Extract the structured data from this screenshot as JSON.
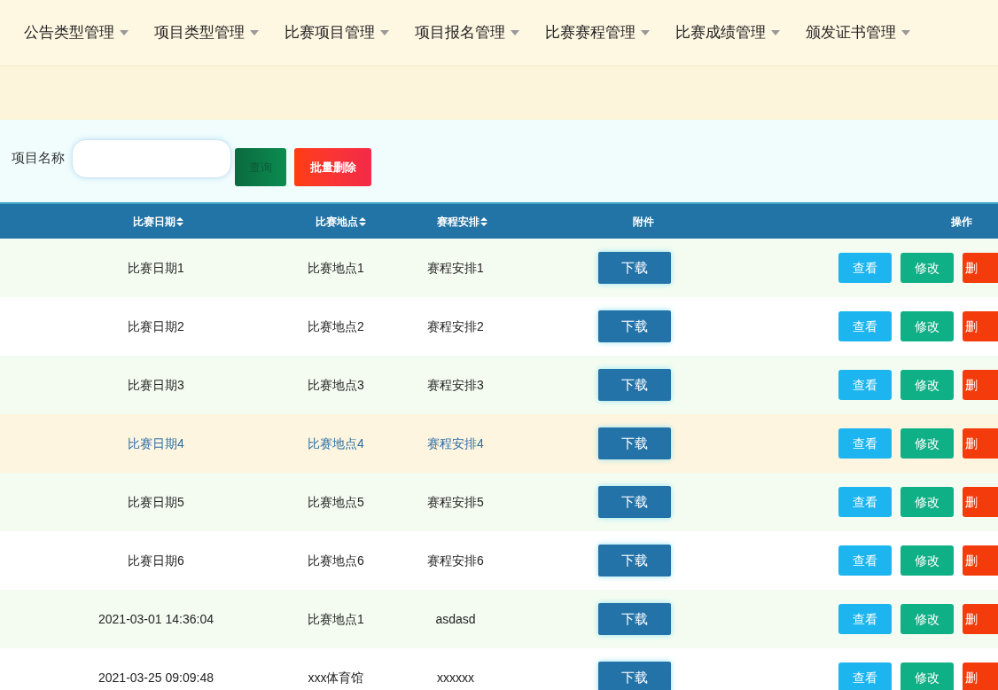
{
  "nav": [
    {
      "label": "公告类型管理"
    },
    {
      "label": "项目类型管理"
    },
    {
      "label": "比赛项目管理"
    },
    {
      "label": "项目报名管理"
    },
    {
      "label": "比赛赛程管理"
    },
    {
      "label": "比赛成绩管理"
    },
    {
      "label": "颁发证书管理"
    }
  ],
  "search": {
    "label": "项目名称",
    "query_button": "查询",
    "batch_delete_button": "批量删除"
  },
  "table": {
    "columns": [
      {
        "label": "比赛日期",
        "sortable": true
      },
      {
        "label": "比赛地点",
        "sortable": true
      },
      {
        "label": "赛程安排",
        "sortable": true
      },
      {
        "label": "附件",
        "sortable": false
      },
      {
        "label": "操作",
        "sortable": false
      }
    ],
    "rows": [
      {
        "cells": [
          "比赛日期1",
          "比赛地点1",
          "赛程安排1"
        ],
        "hovered": false,
        "download": "下载",
        "actions": [
          {
            "kind": "view",
            "label": "查看"
          },
          {
            "kind": "edit",
            "label": "修改"
          },
          {
            "kind": "delete",
            "label": "删"
          }
        ]
      },
      {
        "cells": [
          "比赛日期2",
          "比赛地点2",
          "赛程安排2"
        ],
        "hovered": false,
        "download": "下载",
        "actions": [
          {
            "kind": "view",
            "label": "查看"
          },
          {
            "kind": "edit",
            "label": "修改"
          },
          {
            "kind": "delete",
            "label": "删"
          }
        ]
      },
      {
        "cells": [
          "比赛日期3",
          "比赛地点3",
          "赛程安排3"
        ],
        "hovered": false,
        "download": "下载",
        "actions": [
          {
            "kind": "view",
            "label": "查看"
          },
          {
            "kind": "edit",
            "label": "修改"
          },
          {
            "kind": "delete",
            "label": "删"
          }
        ]
      },
      {
        "cells": [
          "比赛日期4",
          "比赛地点4",
          "赛程安排4"
        ],
        "hovered": true,
        "download": "下载",
        "actions": [
          {
            "kind": "view",
            "label": "查看"
          },
          {
            "kind": "edit",
            "label": "修改"
          },
          {
            "kind": "delete",
            "label": "删"
          }
        ]
      },
      {
        "cells": [
          "比赛日期5",
          "比赛地点5",
          "赛程安排5"
        ],
        "hovered": false,
        "download": "下载",
        "actions": [
          {
            "kind": "view",
            "label": "查看"
          },
          {
            "kind": "edit",
            "label": "修改"
          },
          {
            "kind": "delete",
            "label": "删"
          }
        ]
      },
      {
        "cells": [
          "比赛日期6",
          "比赛地点6",
          "赛程安排6"
        ],
        "hovered": false,
        "download": "下载",
        "actions": [
          {
            "kind": "view",
            "label": "查看"
          },
          {
            "kind": "edit",
            "label": "修改"
          },
          {
            "kind": "delete",
            "label": "删"
          }
        ]
      },
      {
        "cells": [
          "2021-03-01 14:36:04",
          "比赛地点1",
          "asdasd"
        ],
        "hovered": false,
        "download": "下载",
        "actions": [
          {
            "kind": "view",
            "label": "查看"
          },
          {
            "kind": "edit",
            "label": "修改"
          },
          {
            "kind": "delete",
            "label": "删"
          }
        ]
      },
      {
        "cells": [
          "2021-03-25 09:09:48",
          "xxx体育馆",
          "xxxxxx"
        ],
        "hovered": false,
        "download": "下载",
        "actions": [
          {
            "kind": "view",
            "label": "查看"
          },
          {
            "kind": "edit",
            "label": "修改"
          },
          {
            "kind": "delete",
            "label": "删"
          }
        ]
      }
    ]
  }
}
